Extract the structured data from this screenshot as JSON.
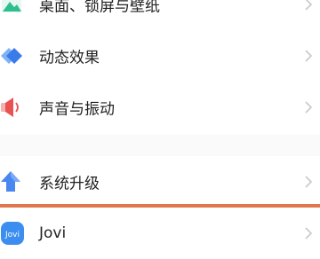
{
  "settings": {
    "items": [
      {
        "label": "桌面、锁屏与壁纸",
        "icon": "wallpaper-icon"
      },
      {
        "label": "动态效果",
        "icon": "dynamic-effects-icon"
      },
      {
        "label": "声音与振动",
        "icon": "sound-vibration-icon"
      },
      {
        "label": "系统升级",
        "icon": "system-update-icon"
      },
      {
        "label": "Jovi",
        "icon": "jovi-icon",
        "icon_text": "Jovi"
      }
    ]
  },
  "colors": {
    "background": "#ffffff",
    "text": "#222222",
    "chevron": "#c8c8c8",
    "highlight_line": "#e0774f",
    "wallpaper_icon": "#2fbf8f",
    "dynamic_icon": "#3a7bea",
    "sound_icon": "#ea5252",
    "update_icon": "#4a86f0",
    "jovi_icon": "#3b8ef0"
  }
}
